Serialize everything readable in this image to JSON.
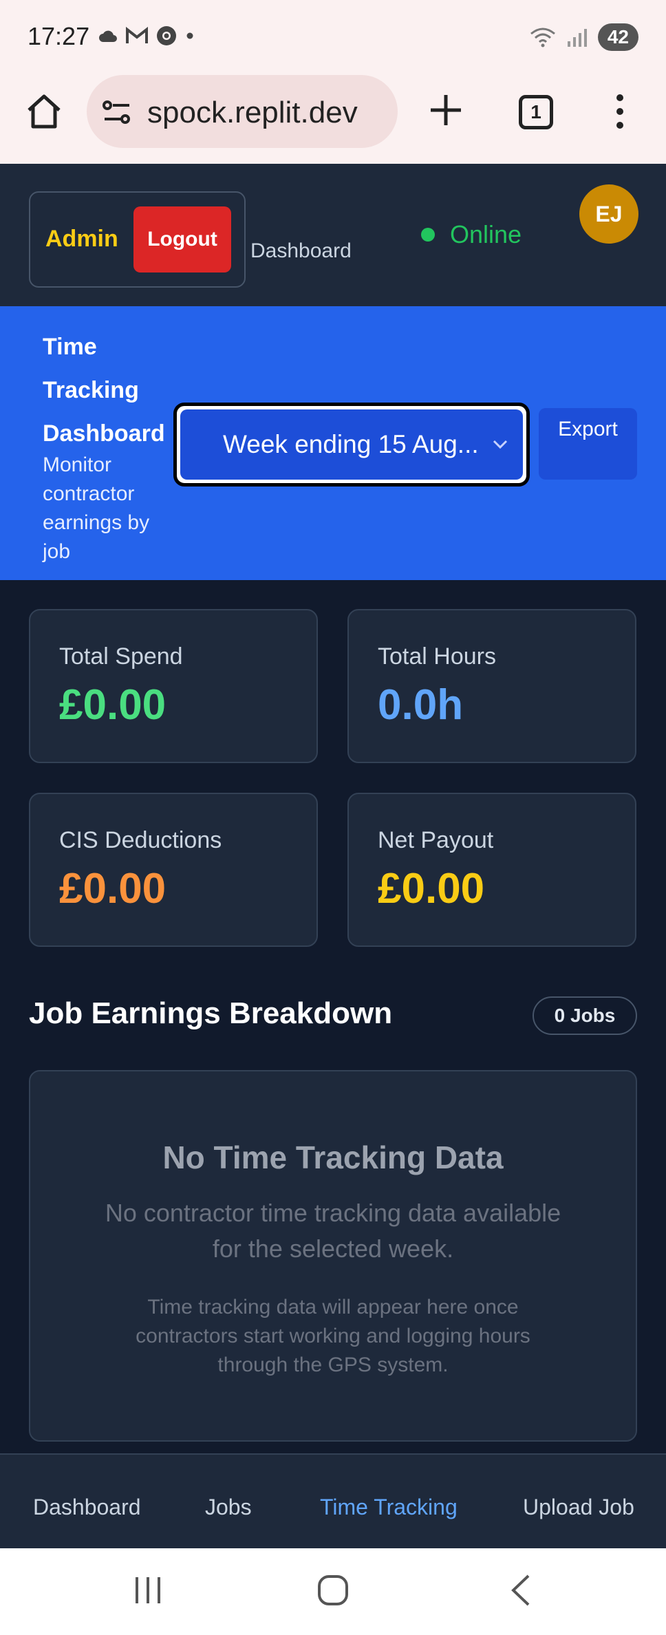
{
  "status_bar": {
    "time": "17:27",
    "battery": "42",
    "notification_icons": [
      "cloud-icon",
      "gmail-icon",
      "chrome-icon",
      "dot-icon"
    ],
    "system_icons": [
      "wifi-icon",
      "signal-icon",
      "battery-icon"
    ]
  },
  "browser": {
    "url": "spock.replit.dev",
    "tab_count": "1"
  },
  "header": {
    "admin_label": "Admin",
    "logout_label": "Logout",
    "dashboard_label": "Dashboard",
    "status": "Online",
    "avatar_initials": "EJ",
    "status_color": "#22c55e"
  },
  "banner": {
    "title": "Time Tracking Dashboard",
    "subtitle": "Monitor contractor earnings by job",
    "week_select": "Week ending 15 Aug...",
    "export_label": "Export"
  },
  "stats": [
    {
      "label": "Total Spend",
      "value": "£0.00",
      "color": "#4ade80"
    },
    {
      "label": "Total Hours",
      "value": "0.0h",
      "color": "#60a5fa"
    },
    {
      "label": "CIS Deductions",
      "value": "£0.00",
      "color": "#fb923c"
    },
    {
      "label": "Net Payout",
      "value": "£0.00",
      "color": "#facc15"
    }
  ],
  "section": {
    "title": "Job Earnings Breakdown",
    "jobs_badge": "0 Jobs"
  },
  "empty_state": {
    "title": "No Time Tracking Data",
    "message": "No contractor time tracking data available for the selected week.",
    "note": "Time tracking data will appear here once contractors start working and logging hours through the GPS system."
  },
  "bottom_nav": {
    "items": [
      "Dashboard",
      "Jobs",
      "Time Tracking",
      "Upload Job"
    ],
    "active": "Time Tracking"
  }
}
